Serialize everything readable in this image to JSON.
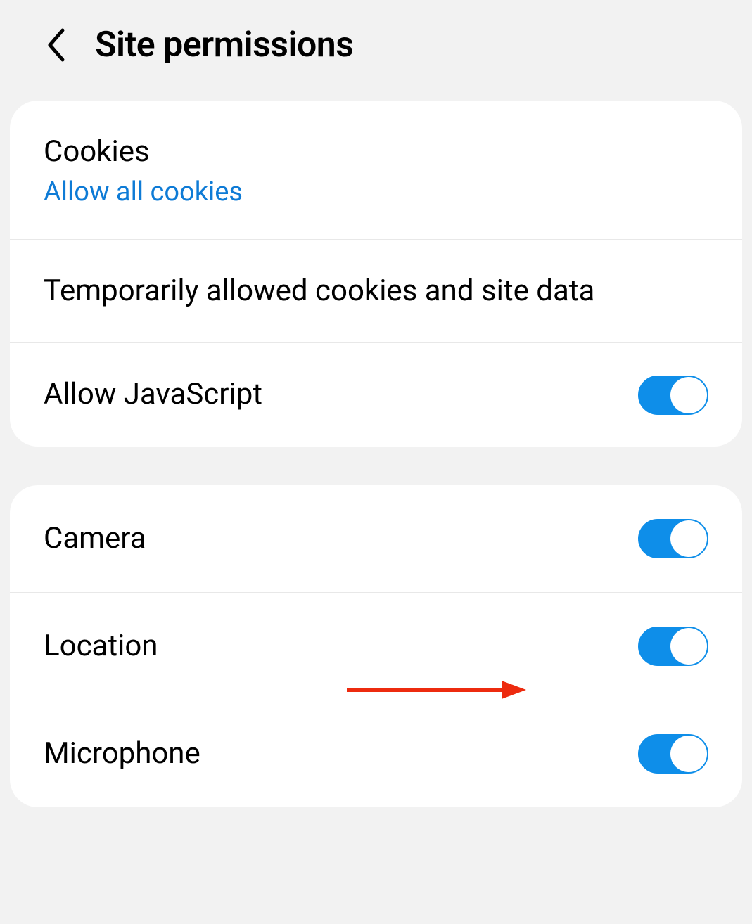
{
  "header": {
    "title": "Site permissions"
  },
  "group1": {
    "items": [
      {
        "title": "Cookies",
        "subtitle": "Allow all cookies"
      },
      {
        "title": "Temporarily allowed cookies and site data"
      },
      {
        "title": "Allow JavaScript",
        "toggle": true
      }
    ]
  },
  "group2": {
    "items": [
      {
        "title": "Camera",
        "toggle": true,
        "divider": true
      },
      {
        "title": "Location",
        "toggle": true,
        "divider": true
      },
      {
        "title": "Microphone",
        "toggle": true,
        "divider": true
      }
    ]
  }
}
